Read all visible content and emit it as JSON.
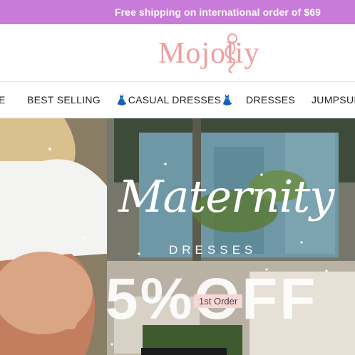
{
  "announcement": {
    "text": "Free shipping on international order of $69"
  },
  "header": {
    "logo_text": "Mojoliy"
  },
  "nav": {
    "items": [
      {
        "label": "E"
      },
      {
        "label": "BEST SELLING"
      },
      {
        "label": "👗CASUAL DRESSES👗"
      },
      {
        "label": "DRESSES"
      },
      {
        "label": "JUMPSUI"
      }
    ]
  },
  "hero": {
    "title": "Maternity",
    "subtitle": "DRESSES",
    "discount": "5%OFF",
    "badge": "1st Order"
  },
  "colors": {
    "announcement_bg": "#c97bd9",
    "logo": "#ef9f9f",
    "badge_bg": "#f7d6d6"
  }
}
